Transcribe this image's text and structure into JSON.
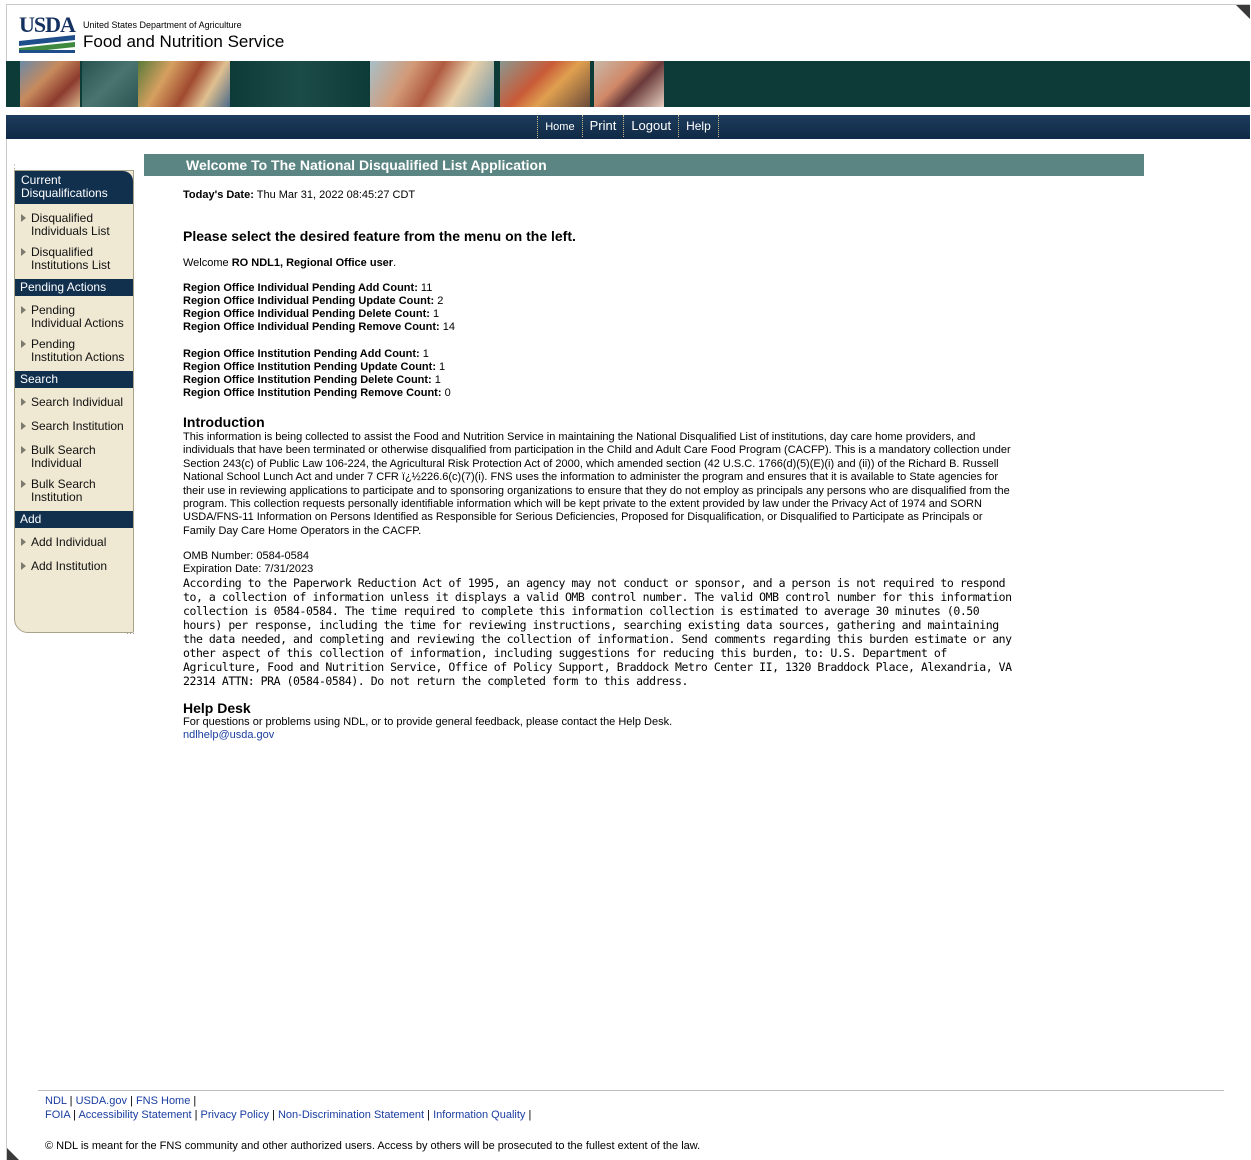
{
  "header": {
    "logo_text": "USDA",
    "agency_small": "United States Department of Agriculture",
    "agency_big": "Food and Nutrition Service"
  },
  "nav": {
    "items": [
      "Home",
      "Print",
      "Logout",
      "Help"
    ]
  },
  "sidebar": {
    "sections": [
      {
        "title": "Current Disqualifications",
        "items": [
          "Disqualified Individuals List",
          "Disqualified Institutions List"
        ]
      },
      {
        "title": "Pending Actions",
        "items": [
          "Pending Individual Actions",
          "Pending Institution Actions"
        ]
      },
      {
        "title": "Search",
        "items": [
          "Search Individual",
          "Search Institution",
          "Bulk Search Individual",
          "Bulk Search Institution"
        ]
      },
      {
        "title": "Add",
        "items": [
          "Add Individual",
          "Add Institution"
        ]
      }
    ]
  },
  "main": {
    "title": "Welcome To The National Disqualified List Application",
    "today_label": "Today's Date:",
    "today_value": "Thu Mar 31, 2022 08:45:27 CDT",
    "select_message": "Please select the desired feature from the menu on the left.",
    "welcome_prefix": "Welcome",
    "welcome_user": "RO NDL1, Regional Office user",
    "welcome_suffix": ".",
    "individual_counts": [
      {
        "label": "Region Office Individual Pending Add Count:",
        "value": "11"
      },
      {
        "label": "Region Office Individual Pending Update Count:",
        "value": "2"
      },
      {
        "label": "Region Office Individual Pending Delete Count:",
        "value": "1"
      },
      {
        "label": "Region Office Individual Pending Remove Count:",
        "value": "14"
      }
    ],
    "institution_counts": [
      {
        "label": "Region Office Institution Pending Add Count:",
        "value": "1"
      },
      {
        "label": "Region Office Institution Pending Update Count:",
        "value": "1"
      },
      {
        "label": "Region Office Institution Pending Delete Count:",
        "value": "1"
      },
      {
        "label": "Region Office Institution Pending Remove Count:",
        "value": "0"
      }
    ],
    "intro_heading": "Introduction",
    "intro_text": "This information is being collected to assist the Food and Nutrition Service in maintaining the National Disqualified List of institutions, day care home providers, and individuals that have been terminated or otherwise disqualified from participation in the Child and Adult Care Food Program (CACFP). This is a mandatory collection under Section 243(c) of Public Law 106-224, the Agricultural Risk Protection Act of 2000, which amended section (42 U.S.C. 1766(d)(5)(E)(i) and (ii)) of the Richard B. Russell National School Lunch Act and under 7 CFR ï¿½226.6(c)(7)(i). FNS uses the information to administer the program and ensures that it is available to State agencies for their use in reviewing applications to participate and to sponsoring organizations to ensure that they do not employ as principals any persons who are disqualified from the program. This collection requests personally identifiable information which will be kept private to the extent provided by law under the Privacy Act of 1974 and SORN USDA/FNS-11 Information on Persons Identified as Responsible for Serious Deficiencies, Proposed for Disqualification, or Disqualified to Participate as Principals or Family Day Care Home Operators in the CACFP.",
    "omb_number": "OMB Number: 0584-0584",
    "expiration": "Expiration Date: 7/31/2023",
    "pra_text": "According to the Paperwork Reduction Act of 1995, an agency may not conduct or sponsor, and a person is not required to respond to, a collection of information unless it displays a valid OMB control number. The valid OMB control number for this information collection is 0584-0584. The time required to complete this information collection is estimated to average 30 minutes (0.50 hours) per response, including the time for reviewing instructions, searching existing data sources, gathering and maintaining the data needed, and completing and reviewing the collection of information. Send comments regarding this burden estimate or any other aspect of this collection of information, including suggestions for reducing this burden, to: U.S. Department of Agriculture, Food and Nutrition Service, Office of Policy Support, Braddock Metro Center II, 1320 Braddock Place, Alexandria, VA 22314 ATTN: PRA (0584-0584). Do not return the completed form to this address.",
    "help_heading": "Help Desk",
    "help_text": "For questions or problems using NDL, or to provide general feedback, please contact the Help Desk.",
    "help_email": "ndlhelp@usda.gov"
  },
  "footer": {
    "row1": [
      "NDL",
      "USDA.gov",
      "FNS Home"
    ],
    "row2": [
      "FOIA",
      "Accessibility Statement",
      "Privacy Policy",
      "Non-Discrimination Statement",
      "Information Quality"
    ],
    "copyright": "© NDL is meant for the FNS community and other authorized users. Access by others will be prosecuted to the fullest extent of the law."
  },
  "colors": {
    "banner": "#0d3b38",
    "navbar": "#10304e",
    "title_bar": "#5b8583",
    "sidebar_bg": "#efe8d2",
    "link": "#1a3da0"
  }
}
